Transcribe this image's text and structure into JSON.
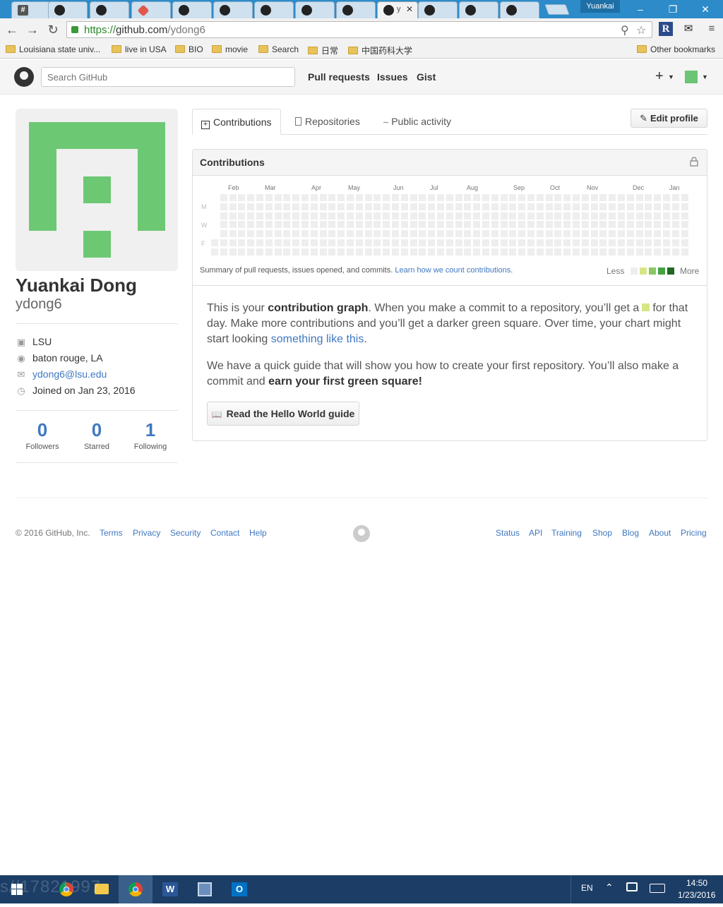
{
  "browser": {
    "tabs": [
      {
        "icon": "hash-icon",
        "label": "#"
      },
      {
        "icon": "github-icon",
        "label": ""
      },
      {
        "icon": "github-icon",
        "label": ""
      },
      {
        "icon": "git-icon",
        "label": ""
      },
      {
        "icon": "github-icon",
        "label": ""
      },
      {
        "icon": "github-icon",
        "label": ""
      },
      {
        "icon": "github-icon",
        "label": ""
      },
      {
        "icon": "github-icon",
        "label": ""
      },
      {
        "icon": "github-icon",
        "label": ""
      },
      {
        "icon": "github-icon",
        "label": "y",
        "active": true
      },
      {
        "icon": "github-icon",
        "label": ""
      },
      {
        "icon": "github-icon",
        "label": ""
      },
      {
        "icon": "github-icon",
        "label": ""
      }
    ],
    "profile_name": "Yuankai",
    "url": {
      "scheme": "https://",
      "host": "github.com",
      "path": "/ydong6"
    },
    "bookmarks": [
      "Louisiana state univ...",
      "live in USA",
      "BIO",
      "movie",
      "Search",
      "日常",
      "中国药科大学"
    ],
    "other_bookmarks": "Other bookmarks"
  },
  "github_header": {
    "search_placeholder": "Search GitHub",
    "nav": [
      "Pull requests",
      "Issues",
      "Gist"
    ],
    "plus": "+"
  },
  "profile": {
    "full_name": "Yuankai Dong",
    "username": "ydong6",
    "organization": "LSU",
    "location": "baton rouge, LA",
    "email": "ydong6@lsu.edu",
    "joined": "Joined on Jan 23, 2016",
    "stats": [
      {
        "value": "0",
        "label": "Followers"
      },
      {
        "value": "0",
        "label": "Starred"
      },
      {
        "value": "1",
        "label": "Following"
      }
    ],
    "avatar_color": "#6dc874"
  },
  "tabs": {
    "contributions": "Contributions",
    "repositories": "Repositories",
    "public_activity": "Public activity",
    "edit_profile": "Edit profile"
  },
  "contributions": {
    "title": "Contributions",
    "months": [
      "Feb",
      "Mar",
      "Apr",
      "May",
      "Jun",
      "Jul",
      "Aug",
      "Sep",
      "Oct",
      "Nov",
      "Dec",
      "Jan"
    ],
    "weekdays": [
      "M",
      "W",
      "F"
    ],
    "summary": "Summary of pull requests, issues opened, and commits.",
    "learn_link": "Learn how we count contributions",
    "legend_less": "Less",
    "legend_more": "More",
    "legend_colors": [
      "#eeeeee",
      "#d6e685",
      "#8cc665",
      "#44a340",
      "#1e6823"
    ],
    "empty_color": "#eeeeee",
    "weeks": 53,
    "total_contributions": 0
  },
  "blurb": {
    "p1_a": "This is your",
    "p1_b": "contribution graph",
    "p1_c": ". When you make a commit to a repository, you’ll get a",
    "p1_d": "for that day. Make more contributions and you’ll get a darker green square. Over time, your chart might start looking",
    "p1_link": "something like this",
    "p1_e": ".",
    "p2_a": "We have a quick guide that will show you how to create your first repository. You’ll also make a commit and",
    "p2_b": "earn your first green square!",
    "button": "Read the Hello World guide"
  },
  "footer": {
    "copyright": "© 2016 GitHub, Inc.",
    "left_links": [
      "Terms",
      "Privacy",
      "Security",
      "Contact",
      "Help"
    ],
    "right_links": [
      "Status",
      "API",
      "Training",
      "Shop",
      "Blog",
      "About",
      "Pricing"
    ]
  },
  "taskbar": {
    "watermark": "s//17821997",
    "language": "EN",
    "time": "14:50",
    "date": "1/23/2016"
  }
}
